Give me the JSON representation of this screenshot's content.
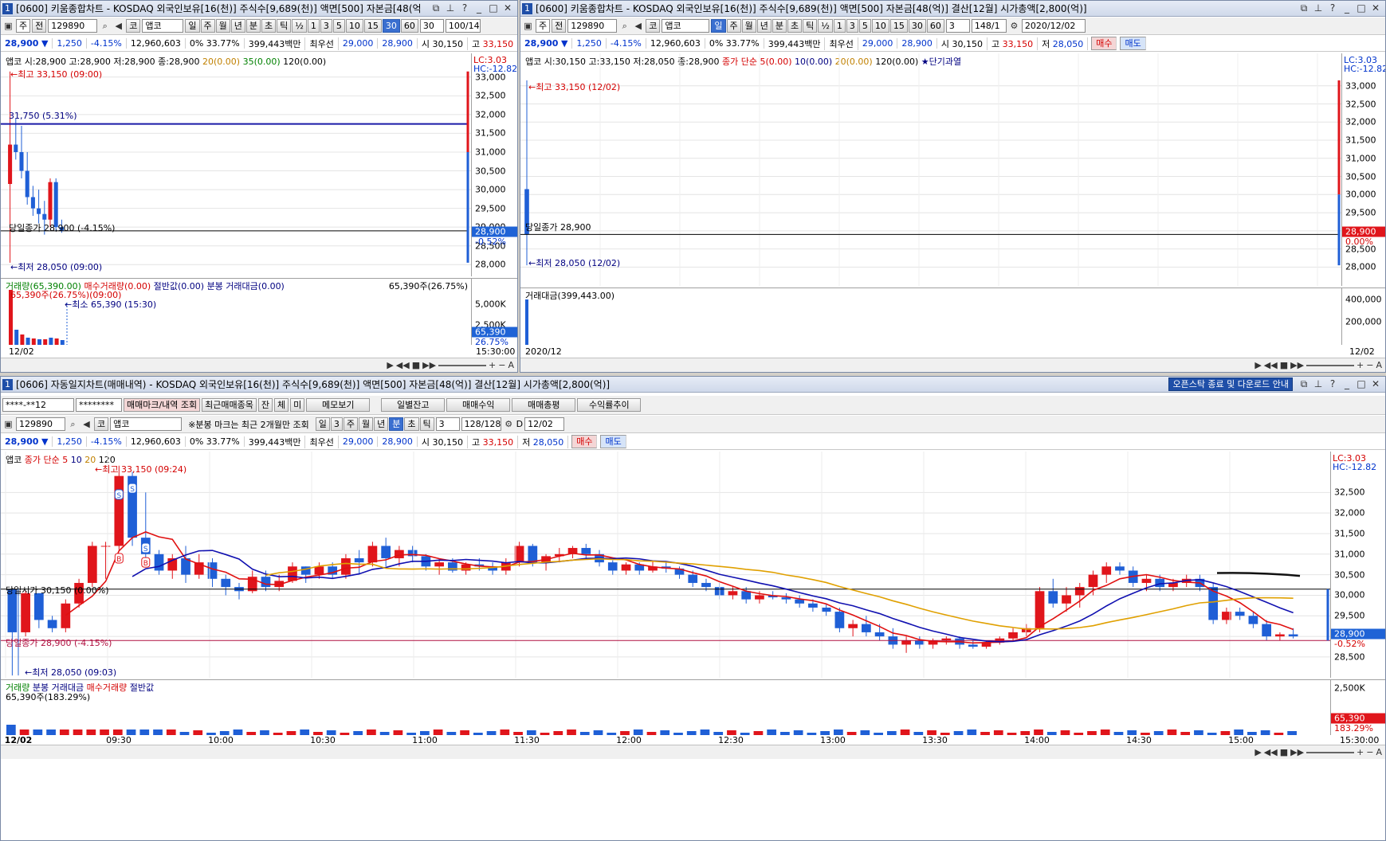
{
  "top_left": {
    "title_num": "1",
    "title": "[0600] 키움종합차트 - KOSDAQ 외국인보유[16(천)] 주식수[9,689(천)] 액면[500] 자본금[48(억",
    "toolbar": {
      "type": "주",
      "type2": "전",
      "code": "129890",
      "market": "코",
      "name": "앱코",
      "periods": [
        "일",
        "주",
        "월",
        "년",
        "분",
        "초",
        "틱",
        "½",
        "1",
        "3",
        "5",
        "10",
        "15",
        "30",
        "60"
      ],
      "selected_period": "30",
      "count": "30",
      "ratio": "100/14"
    },
    "quote": {
      "price": "28,900",
      "arrow": "▼",
      "change": "1,250",
      "rate": "-4.15%",
      "volume": "12,960,603",
      "pct": "0% 33.77%",
      "amount": "399,443백만",
      "best_label": "최우선",
      "ask": "29,000",
      "bid": "28,900",
      "open_label": "시",
      "open": "30,150",
      "high_label": "고",
      "high": "33,150",
      "extra": "저 2"
    },
    "legend": {
      "ohlc": "앱코 시:28,900 고:28,900 저:28,900 종:28,900",
      "ma20": "20(0.00)",
      "ma35": "35(0.00)",
      "ma120": "120(0.00)"
    },
    "lc": "LC:3.03",
    "hc": "HC:-12.82",
    "yticks": [
      "33,000",
      "32,500",
      "32,000",
      "31,500",
      "31,000",
      "30,500",
      "30,000",
      "29,500",
      "29,000",
      "28,500",
      "28,000"
    ],
    "high_ann": "최고 33,150 (09:00)",
    "level_ann": "31,750 (5.31%)",
    "close_ann": "당일종가 28,900 (-4.15%)",
    "low_ann": "최저 28,050 (09:00)",
    "price_tag": "28,900",
    "price_pct": "-0.52%",
    "vol_legend": {
      "vol": "거래량(65,390.00)",
      "buy": "매수거래량(0.00)",
      "half": "절반값(0.00)",
      "amt": "분봉 거래대금(0.00)",
      "right": "65,390주(26.75%)"
    },
    "vol_ann1": "65,390주(26.75%)(09:00)",
    "vol_ann2": "최소 65,390 (15:30)",
    "vol_ticks": [
      "5,000K",
      "2,500K"
    ],
    "vol_tag": "65,390",
    "vol_pct": "26.75%",
    "date": "12/02",
    "time": "15:30:00"
  },
  "top_right": {
    "title_num": "1",
    "title": "[0600] 키움종합차트 - KOSDAQ 외국인보유[16(천)] 주식수[9,689(천)] 액면[500] 자본금[48(억)] 결산[12월] 시가총액[2,800(억)]",
    "toolbar": {
      "type": "주",
      "type2": "전",
      "code": "129890",
      "market": "코",
      "name": "앱코",
      "periods": [
        "일",
        "주",
        "월",
        "년",
        "분",
        "초",
        "틱",
        "½",
        "1",
        "3",
        "5",
        "10",
        "15",
        "30",
        "60"
      ],
      "selected_period": "일",
      "count": "3",
      "ratio": "148/1",
      "date": "2020/12/02"
    },
    "quote": {
      "price": "28,900",
      "arrow": "▼",
      "change": "1,250",
      "rate": "-4.15%",
      "volume": "12,960,603",
      "pct": "0% 33.77%",
      "amount": "399,443백만",
      "best_label": "최우선",
      "ask": "29,000",
      "bid": "28,900",
      "open_label": "시",
      "open": "30,150",
      "high_label": "고",
      "high": "33,150",
      "low_label": "저",
      "low": "28,050",
      "buy": "매수",
      "sell": "매도"
    },
    "legend": {
      "ohlc": "앱코 시:30,150 고:33,150 저:28,050 종:28,900",
      "ma5": "종가 단순 5(0.00)",
      "ma10": "10(0.00)",
      "ma20": "20(0.00)",
      "ma120": "120(0.00)",
      "star": "★단기과열"
    },
    "lc": "LC:3.03",
    "hc": "HC:-12.82",
    "yticks": [
      "33,000",
      "32,500",
      "32,000",
      "31,500",
      "31,000",
      "30,500",
      "30,000",
      "29,500",
      "29,000",
      "28,500",
      "28,000"
    ],
    "high_ann": "최고 33,150 (12/02)",
    "close_ann": "당일종가 28,900",
    "low_ann": "최저 28,050 (12/02)",
    "price_tag": "28,900",
    "price_pct": "0.00%",
    "vol_legend": "거래대금(399,443.00)",
    "vol_ticks": [
      "400,000",
      "200,000"
    ],
    "date_left": "2020/12",
    "date_right": "12/02"
  },
  "bottom": {
    "title_num": "1",
    "title": "[0606] 자동일지차트(매매내역) - KOSDAQ 외국인보유[16(천)] 주식수[9,689(천)] 액면[500] 자본금[48(억)] 결산[12월] 시가총액[2,800(억)]",
    "download": "오픈스탁 종료 및 다운로드 안내",
    "toolbar1": {
      "account": "****-**12",
      "password": "********",
      "mark_btn": "매매마크/내역 조회",
      "recent_btn": "최근매매종목",
      "b1": "잔",
      "b2": "체",
      "b3": "미",
      "memo_btn": "메모보기",
      "daily_btn": "일별잔고",
      "profit_btn": "매매수익",
      "eval_btn": "매매총평",
      "trend_btn": "수익률추이"
    },
    "toolbar2": {
      "code": "129890",
      "market": "코",
      "name": "앱코",
      "note": "※분봉 마크는 최근 2개월만 조회",
      "periods": [
        "일",
        "3",
        "주",
        "월",
        "년",
        "분",
        "초",
        "틱"
      ],
      "count": "3",
      "ratio": "128/128",
      "date": "12/02",
      "d": "D"
    },
    "quote": {
      "price": "28,900",
      "arrow": "▼",
      "change": "1,250",
      "rate": "-4.15%",
      "volume": "12,960,603",
      "pct": "0% 33.77%",
      "amount": "399,443백만",
      "best_label": "최우선",
      "ask": "29,000",
      "bid": "28,900",
      "open_label": "시",
      "open": "30,150",
      "high_label": "고",
      "high": "33,150",
      "low_label": "저",
      "low": "28,050",
      "buy": "매수",
      "sell": "매도"
    },
    "legend": {
      "name": "앱코",
      "ma": "종가 단순 5",
      "m10": "10",
      "m20": "20",
      "m120": "120"
    },
    "lc": "LC:3.03",
    "hc": "HC:-12.82",
    "yticks": [
      "32,500",
      "32,000",
      "31,500",
      "31,000",
      "30,500",
      "30,000",
      "29,500",
      "29,000",
      "28,500"
    ],
    "high_ann": "최고 33,150 (09:24)",
    "open_ann": "당일시가 30,150 (0.00%)",
    "close_ann": "당일종가 28,900 (-4.15%)",
    "low_ann": "최저 28,050 (09:03)",
    "price_tag": "28,900",
    "price_pct": "-0.52%",
    "vol_legend": {
      "vol": "거래량",
      "amt": "분봉 거래대금",
      "buy": "매수거래량",
      "half": "절반값",
      "val": "65,390주(183.29%)"
    },
    "vol_ticks": [
      "2,500K"
    ],
    "vol_tag": "65,390",
    "vol_pct": "183.29%",
    "xticks": [
      "12/02",
      "09:30",
      "10:00",
      "10:30",
      "11:00",
      "11:30",
      "12:00",
      "12:30",
      "13:00",
      "13:30",
      "14:00",
      "14:30",
      "15:00"
    ],
    "time": "15:30:00",
    "colors": {
      "up": "#e0151b",
      "down": "#1f5fd6",
      "ma5": "#e01010",
      "ma10": "#1010b0",
      "ma20": "#e0a000"
    }
  },
  "chart_data": [
    {
      "type": "candlestick",
      "title": "앱코 30분봉",
      "ylim": [
        27900,
        33250
      ],
      "candles": [
        [
          30150,
          33150,
          28050,
          31200
        ],
        [
          31200,
          31900,
          30800,
          31000
        ],
        [
          31000,
          31700,
          30300,
          30500
        ],
        [
          30500,
          31000,
          29600,
          29800
        ],
        [
          29800,
          30100,
          29300,
          29500
        ],
        [
          29500,
          30000,
          29100,
          29350
        ],
        [
          29350,
          29700,
          28800,
          29200
        ],
        [
          29200,
          30300,
          29000,
          30200
        ],
        [
          30200,
          30300,
          28900,
          29000
        ],
        [
          29000,
          29200,
          28850,
          28900
        ]
      ]
    },
    {
      "type": "candlestick",
      "title": "앱코 일봉",
      "ylim": [
        27700,
        33500
      ],
      "candles": [
        [
          30150,
          33150,
          28050,
          28900
        ]
      ]
    },
    {
      "type": "candlestick",
      "title": "앱코 3분봉",
      "ylim": [
        28150,
        33300
      ],
      "candles": [
        [
          30150,
          30150,
          28050,
          29100
        ],
        [
          29100,
          30100,
          29000,
          30050
        ],
        [
          30050,
          30050,
          29200,
          29400
        ],
        [
          29400,
          29500,
          29100,
          29200
        ],
        [
          29200,
          29900,
          29100,
          29800
        ],
        [
          29800,
          30400,
          29700,
          30300
        ],
        [
          30300,
          31300,
          30200,
          31200
        ],
        [
          31200,
          31300,
          30400,
          31200
        ],
        [
          31200,
          33150,
          31100,
          32900
        ],
        [
          32900,
          33000,
          31200,
          31400
        ],
        [
          31400,
          32500,
          30700,
          31000
        ],
        [
          31000,
          31100,
          30500,
          30600
        ],
        [
          30600,
          31000,
          30400,
          30900
        ],
        [
          30900,
          31200,
          30300,
          30500
        ],
        [
          30500,
          31000,
          30400,
          30800
        ],
        [
          30800,
          30900,
          30200,
          30400
        ],
        [
          30400,
          30500,
          30000,
          30200
        ],
        [
          30200,
          30300,
          29900,
          30100
        ],
        [
          30100,
          30600,
          30050,
          30450
        ],
        [
          30450,
          30600,
          30100,
          30200
        ],
        [
          30200,
          30500,
          30100,
          30350
        ],
        [
          30350,
          30800,
          30300,
          30700
        ],
        [
          30700,
          30700,
          30300,
          30500
        ],
        [
          30500,
          30800,
          30400,
          30700
        ],
        [
          30700,
          30800,
          30400,
          30500
        ],
        [
          30500,
          31000,
          30400,
          30900
        ],
        [
          30900,
          31100,
          30500,
          30800
        ],
        [
          30800,
          31300,
          30700,
          31200
        ],
        [
          31200,
          31400,
          30700,
          30900
        ],
        [
          30900,
          31200,
          30700,
          31100
        ],
        [
          31100,
          31200,
          30800,
          30950
        ],
        [
          30950,
          31000,
          30600,
          30700
        ],
        [
          30700,
          30900,
          30500,
          30800
        ],
        [
          30800,
          30900,
          30550,
          30600
        ],
        [
          30600,
          30800,
          30500,
          30750
        ],
        [
          30750,
          30900,
          30600,
          30700
        ],
        [
          30700,
          30800,
          30500,
          30600
        ],
        [
          30600,
          30900,
          30500,
          30800
        ],
        [
          30800,
          31300,
          30700,
          31200
        ],
        [
          31200,
          31250,
          30700,
          30800
        ],
        [
          30800,
          31000,
          30600,
          30950
        ],
        [
          30950,
          31150,
          30800,
          31000
        ],
        [
          31000,
          31200,
          30900,
          31150
        ],
        [
          31150,
          31250,
          30900,
          31000
        ],
        [
          31000,
          31100,
          30700,
          30800
        ],
        [
          30800,
          30850,
          30500,
          30600
        ],
        [
          30600,
          30800,
          30500,
          30750
        ],
        [
          30750,
          30800,
          30500,
          30600
        ],
        [
          30600,
          30850,
          30550,
          30700
        ],
        [
          30700,
          30800,
          30550,
          30650
        ],
        [
          30650,
          30700,
          30400,
          30500
        ],
        [
          30500,
          30600,
          30200,
          30300
        ],
        [
          30300,
          30400,
          30100,
          30200
        ],
        [
          30200,
          30300,
          29900,
          30000
        ],
        [
          30000,
          30200,
          29900,
          30100
        ],
        [
          30100,
          30200,
          29800,
          29900
        ],
        [
          29900,
          30100,
          29800,
          30000
        ],
        [
          30000,
          30100,
          29900,
          29950
        ],
        [
          29950,
          30050,
          29800,
          29900
        ],
        [
          29900,
          30000,
          29700,
          29800
        ],
        [
          29800,
          29900,
          29600,
          29700
        ],
        [
          29700,
          29800,
          29500,
          29600
        ],
        [
          29600,
          29700,
          29100,
          29200
        ],
        [
          29200,
          29400,
          29000,
          29300
        ],
        [
          29300,
          29500,
          29000,
          29100
        ],
        [
          29100,
          29300,
          28900,
          29000
        ],
        [
          29000,
          29200,
          28700,
          28800
        ],
        [
          28800,
          29000,
          28600,
          28900
        ],
        [
          28900,
          29000,
          28700,
          28800
        ],
        [
          28800,
          28950,
          28700,
          28900
        ],
        [
          28900,
          29000,
          28800,
          28950
        ],
        [
          28950,
          29000,
          28700,
          28800
        ],
        [
          28800,
          28900,
          28700,
          28750
        ],
        [
          28750,
          28900,
          28700,
          28850
        ],
        [
          28850,
          29000,
          28800,
          28950
        ],
        [
          28950,
          29200,
          28900,
          29100
        ],
        [
          29100,
          29300,
          29000,
          29200
        ],
        [
          29200,
          30200,
          29100,
          30100
        ],
        [
          30100,
          30400,
          29700,
          29800
        ],
        [
          29800,
          30200,
          29600,
          30000
        ],
        [
          30000,
          30300,
          29700,
          30200
        ],
        [
          30200,
          30600,
          30000,
          30500
        ],
        [
          30500,
          30800,
          30300,
          30700
        ],
        [
          30700,
          30800,
          30500,
          30600
        ],
        [
          30600,
          30700,
          30200,
          30300
        ],
        [
          30300,
          30500,
          30100,
          30400
        ],
        [
          30400,
          30500,
          30100,
          30200
        ],
        [
          30200,
          30400,
          30100,
          30300
        ],
        [
          30300,
          30500,
          30200,
          30400
        ],
        [
          30400,
          30500,
          30100,
          30200
        ],
        [
          30200,
          30300,
          29300,
          29400
        ],
        [
          29400,
          29700,
          29300,
          29600
        ],
        [
          29600,
          29700,
          29400,
          29500
        ],
        [
          29500,
          29600,
          29200,
          29300
        ],
        [
          29300,
          29400,
          28900,
          29000
        ],
        [
          29000,
          29100,
          28900,
          29050
        ],
        [
          29050,
          29200,
          28950,
          29000
        ]
      ]
    }
  ]
}
